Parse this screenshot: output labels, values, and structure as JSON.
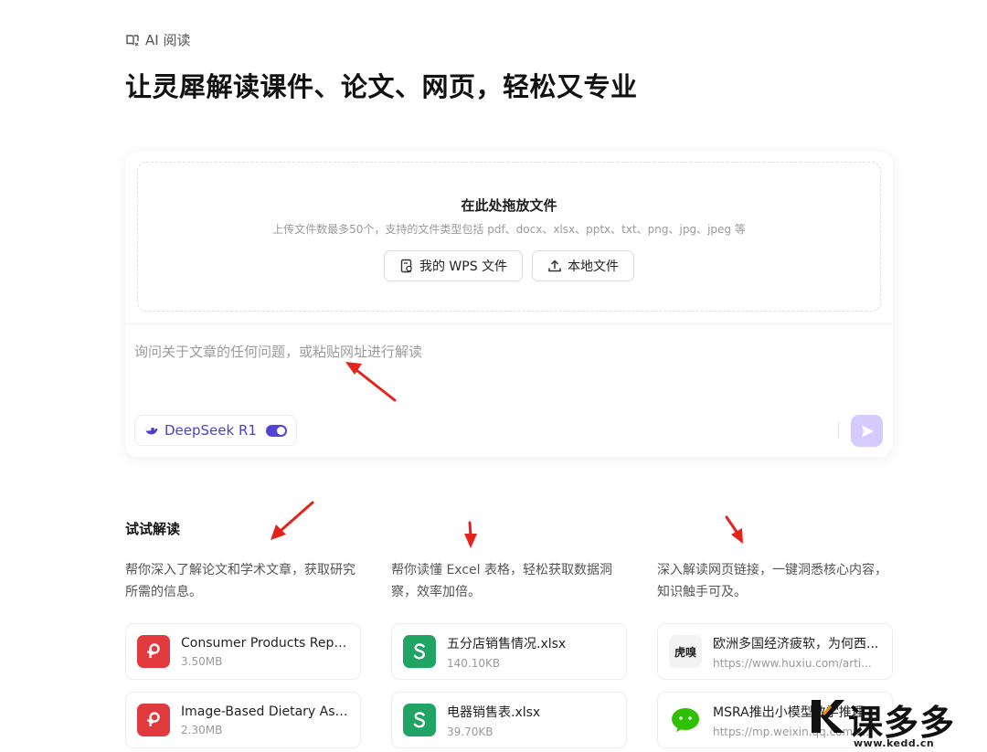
{
  "header": {
    "breadcrumb": "AI 阅读",
    "title": "让灵犀解读课件、论文、网页，轻松又专业"
  },
  "composer": {
    "drop_title": "在此处拖放文件",
    "drop_hint": "上传文件数最多50个，支持的文件类型包括 pdf、docx、xlsx、pptx、txt、png、jpg、jpeg 等",
    "wps_button": "我的 WPS 文件",
    "local_button": "本地文件",
    "input_placeholder": "询问关于文章的任何问题，或粘贴网址进行解读",
    "model_label": "DeepSeek R1",
    "model_enabled": true
  },
  "try": {
    "title": "试试解读",
    "columns": [
      {
        "desc": "帮你深入了解论文和学术文章，获取研究所需的信息。",
        "cards": [
          {
            "name": "Consumer Products Repo...",
            "meta": "3.50MB",
            "icon": "pdf-icon"
          },
          {
            "name": "Image-Based Dietary Ass...",
            "meta": "2.30MB",
            "icon": "pdf-icon"
          }
        ]
      },
      {
        "desc": "帮你读懂 Excel 表格，轻松获取数据洞察，效率加倍。",
        "cards": [
          {
            "name": "五分店销售情况.xlsx",
            "meta": "140.10KB",
            "icon": "spreadsheet-icon"
          },
          {
            "name": "电器销售表.xlsx",
            "meta": "39.70KB",
            "icon": "spreadsheet-icon"
          }
        ]
      },
      {
        "desc": "深入解读网页链接，一键洞悉核心内容，知识触手可及。",
        "cards": [
          {
            "name": "欧洲多国经济疲软，为何西...",
            "meta": "https://www.huxiu.com/arti...",
            "icon": "huxiu-logo-icon",
            "logo_text": "虎嗅"
          },
          {
            "name": "MSRA推出小模型数学推理",
            "meta": "https://mp.weixin.qq.com/s...",
            "icon": "wechat-icon"
          }
        ]
      }
    ]
  },
  "watermark": {
    "text": "课多多",
    "url": "www.kedd.cn"
  },
  "colors": {
    "accent": "#5145d6",
    "send_bg": "#d6cbff",
    "pdf_red": "#e03a3e",
    "sheet_green": "#1fa463",
    "annotation_red": "#e5231b"
  }
}
